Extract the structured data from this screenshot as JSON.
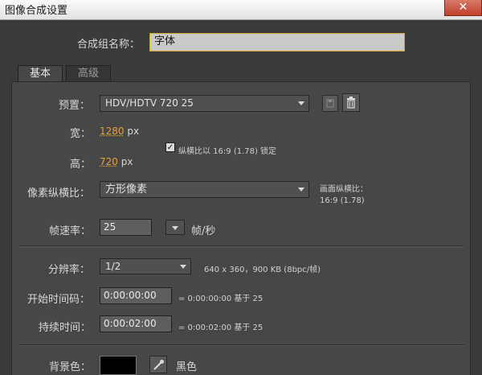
{
  "window": {
    "title": "图像合成设置",
    "close_symbol": "✕"
  },
  "composition_name": {
    "label": "合成组名称：",
    "value": "字体"
  },
  "tabs": [
    {
      "label": "基本",
      "active": true
    },
    {
      "label": "高级",
      "active": false
    }
  ],
  "preset": {
    "label": "预置：",
    "value": "HDV/HDTV 720 25"
  },
  "width": {
    "label": "宽：",
    "value": "1280",
    "unit": "px"
  },
  "height": {
    "label": "高：",
    "value": "720",
    "unit": "px"
  },
  "lock_aspect": {
    "label": "纵横比以 16:9 (1.78) 锁定",
    "checked": true
  },
  "pixel_aspect": {
    "label": "像素纵横比：",
    "value": "方形像素"
  },
  "frame_aspect": {
    "label": "画面纵横比：",
    "value": "16:9 (1.78)"
  },
  "frame_rate": {
    "label": "帧速率：",
    "value": "25",
    "unit": "帧/秒"
  },
  "resolution": {
    "label": "分辨率：",
    "value": "1/2",
    "info": "640 x 360，900 KB (8bpc/帧)"
  },
  "start_timecode": {
    "label": "开始时间码：",
    "value": "0:00:00:00",
    "info": "= 0:00:00:00  基于 25"
  },
  "duration": {
    "label": "持续时间：",
    "value": "0:00:02:00",
    "info": "= 0:00:02:00  基于 25"
  },
  "background": {
    "label": "背景色：",
    "color_name": "黑色",
    "color": "#000000"
  }
}
